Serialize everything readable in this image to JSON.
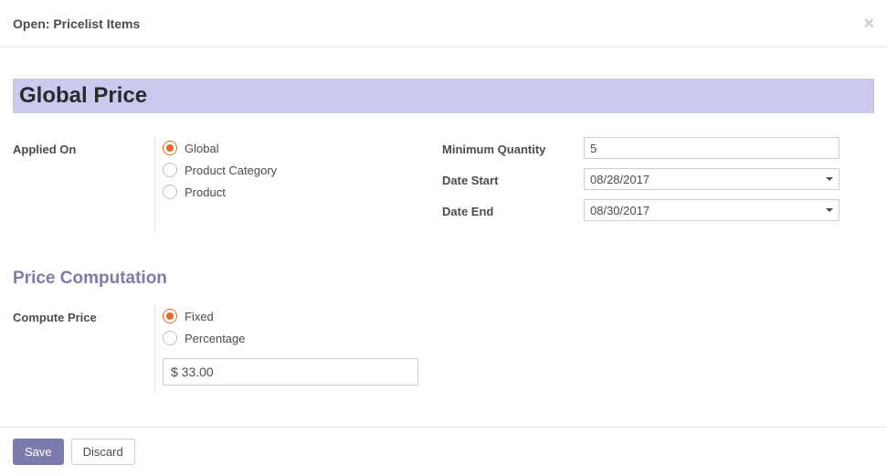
{
  "dialog": {
    "title": "Open: Pricelist Items",
    "close": "×"
  },
  "record": {
    "name": "Global Price"
  },
  "applied": {
    "label": "Applied On",
    "options": {
      "global": "Global",
      "category": "Product Category",
      "product": "Product"
    },
    "selected": "global"
  },
  "right": {
    "min_qty_label": "Minimum Quantity",
    "min_qty": "5",
    "date_start_label": "Date Start",
    "date_start": "08/28/2017",
    "date_end_label": "Date End",
    "date_end": "08/30/2017"
  },
  "section": {
    "price_computation": "Price Computation"
  },
  "compute": {
    "label": "Compute Price",
    "options": {
      "fixed": "Fixed",
      "percentage": "Percentage"
    },
    "selected": "fixed",
    "value": "$ 33.00"
  },
  "footer": {
    "save": "Save",
    "discard": "Discard"
  }
}
